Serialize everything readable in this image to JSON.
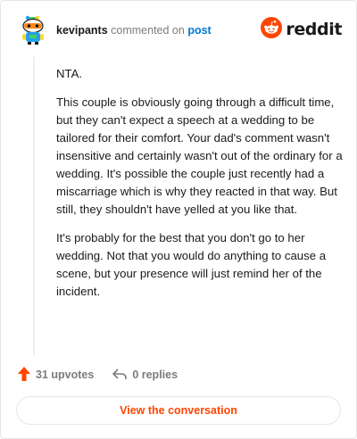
{
  "header": {
    "username": "kevipants",
    "action_text": "commented on",
    "post_link": "post",
    "brand_name": "reddit",
    "brand_color": "#ff4500",
    "avatar_icon": "snoo-avatar-icon"
  },
  "comment": {
    "paragraphs": [
      "NTA.",
      "This couple is obviously going through a difficult time, but they can't expect a speech at a wedding to be tailored for their comfort. Your dad's comment wasn't insensitive and certainly wasn't out of the ordinary for a wedding. It's possible the couple just recently had a miscarriage which is why they reacted in that way. But still, they shouldn't have yelled at you like that.",
      "It's probably for the best that you don't go to her wedding. Not that you would do anything to cause a scene, but your presence will just remind her of the incident."
    ]
  },
  "footer": {
    "upvotes_label": "31 upvotes",
    "replies_label": "0 replies",
    "upvote_icon": "upvote-arrow-icon",
    "reply_icon": "reply-arrow-icon"
  },
  "cta": {
    "label": "View the conversation"
  }
}
